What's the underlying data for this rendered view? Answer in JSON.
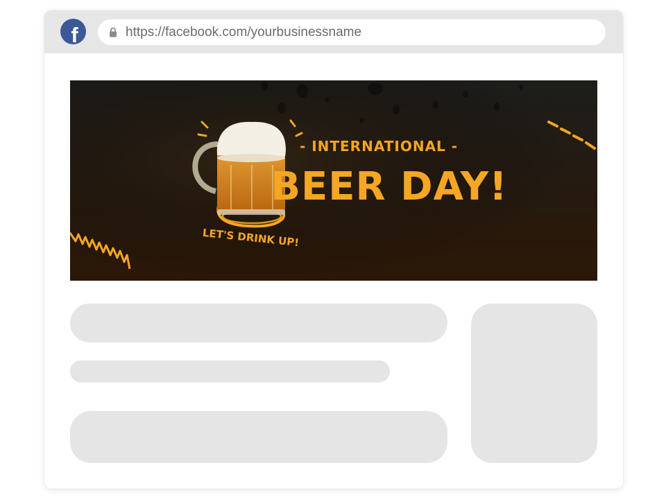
{
  "browser": {
    "url": "https://facebook.com/yourbusinessname",
    "logo_letter": "f",
    "icons": {
      "site": "facebook-logo-icon",
      "secure": "lock-icon"
    }
  },
  "cover": {
    "line1": "- INTERNATIONAL -",
    "headline": "BEER DAY!",
    "tagline": "LET'S DRINK UP!",
    "colors": {
      "accent": "#f5a623",
      "background_top": "#1f1f1d",
      "background_bottom": "#2a1605"
    }
  },
  "colors": {
    "frame_bar": "#e6e6e6",
    "placeholder": "#e5e5e5",
    "facebook_blue": "#3b5998"
  }
}
